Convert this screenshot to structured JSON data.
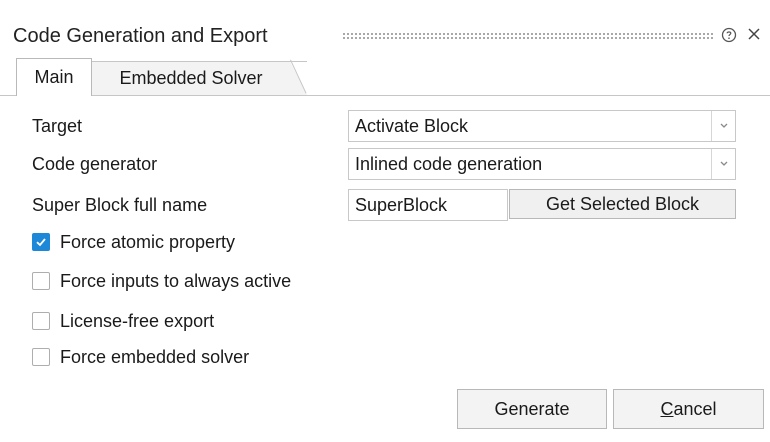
{
  "window": {
    "title": "Code Generation and Export",
    "help_icon": "help-circle-icon",
    "close_icon": "close-icon"
  },
  "tabs": [
    {
      "label": "Main",
      "active": true
    },
    {
      "label": "Embedded Solver",
      "active": false
    }
  ],
  "form": {
    "target": {
      "label": "Target",
      "value": "Activate Block"
    },
    "code_generator": {
      "label": "Code generator",
      "value": "Inlined code generation"
    },
    "superblock": {
      "label": "Super Block full name",
      "value": "SuperBlock",
      "button_label": "Get Selected Block"
    }
  },
  "options": [
    {
      "label": "Force atomic property",
      "checked": true
    },
    {
      "label": "Force inputs to always active",
      "checked": false
    },
    {
      "label": "License-free export",
      "checked": false
    },
    {
      "label": "Force embedded solver",
      "checked": false
    }
  ],
  "buttons": {
    "generate": "Generate",
    "cancel_mnemonic": "C",
    "cancel_rest": "ancel"
  },
  "colors": {
    "accent": "#1e88d8",
    "button_bg": "#f3f3f3",
    "border": "#c8c8c8"
  }
}
